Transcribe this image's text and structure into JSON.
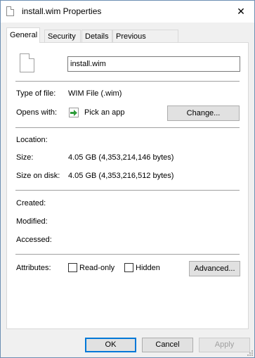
{
  "window": {
    "title": "install.wim Properties",
    "close_glyph": "✕"
  },
  "tabs": [
    {
      "label": "General",
      "active": true
    },
    {
      "label": "Security",
      "active": false
    },
    {
      "label": "Details",
      "active": false
    },
    {
      "label": "Previous Versions",
      "active": false
    }
  ],
  "general": {
    "file_name": "install.wim",
    "type_label": "Type of file:",
    "type_value": "WIM File (.wim)",
    "opens_label": "Opens with:",
    "opens_value": "Pick an app",
    "change_button": "Change...",
    "location_label": "Location:",
    "location_value": "",
    "size_label": "Size:",
    "size_value": "4.05 GB (4,353,214,146 bytes)",
    "size_on_disk_label": "Size on disk:",
    "size_on_disk_value": "4.05 GB (4,353,216,512 bytes)",
    "created_label": "Created:",
    "modified_label": "Modified:",
    "accessed_label": "Accessed:",
    "attributes_label": "Attributes:",
    "readonly_label": "Read-only",
    "readonly_checked": false,
    "hidden_label": "Hidden",
    "hidden_checked": false,
    "advanced_button": "Advanced..."
  },
  "footer": {
    "ok": "OK",
    "cancel": "Cancel",
    "apply": "Apply"
  },
  "icons": {
    "file": "document-icon",
    "app": "pick-app-arrow-icon"
  },
  "colors": {
    "accent": "#0078d7",
    "app_arrow": "#2e9c3a"
  }
}
